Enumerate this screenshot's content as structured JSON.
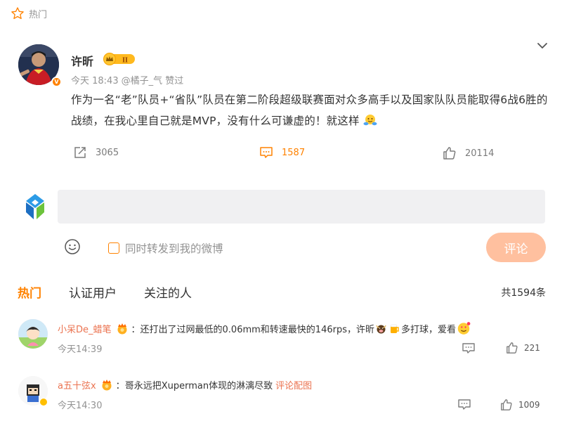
{
  "hot_section": {
    "label": "热门",
    "accent": "#ff8200"
  },
  "post": {
    "author": "许昕",
    "level_badge": "II",
    "verified_badge": "V",
    "time": "今天 18:43",
    "liked_by": "@橘子_气 赞过",
    "text": "作为一名“老”队员+“省队”队员在第二阶段超级联赛面对众多高手以及国家队队员能取得6战6胜的战绩，在我心里自己就是MVP，没有什么可谦虚的！就这样",
    "repost_count": "3065",
    "comment_count": "1587",
    "like_count": "20114"
  },
  "composer": {
    "input_value": "",
    "placeholder": "",
    "repost_checkbox_label": "同时转发到我的微博",
    "submit_label": "评论"
  },
  "tabs": [
    {
      "label": "热门",
      "active": true
    },
    {
      "label": "认证用户",
      "active": false
    },
    {
      "label": "关注的人",
      "active": false
    }
  ],
  "total_comments": "共1594条",
  "comments": [
    {
      "user": "小呆De_蜡笔",
      "separator": "：",
      "text_a": "还打出了过网最低的0.06mm和转速最快的146rps，许昕",
      "text_b": "多打球，爱看",
      "time": "今天14:39",
      "like_count": "221"
    },
    {
      "user": "a五十弦x",
      "separator": "：",
      "text_a": "哥永远把Xuperman体现的淋漓尽致",
      "image_link": "评论配图",
      "time": "今天14:30",
      "like_count": "1009"
    }
  ],
  "colors": {
    "accent_orange": "#ff8200",
    "username_link": "#eb7350",
    "meta_gray": "#939393",
    "input_bg": "#f0f0f2",
    "submit_disabled": "#ffc09f"
  }
}
